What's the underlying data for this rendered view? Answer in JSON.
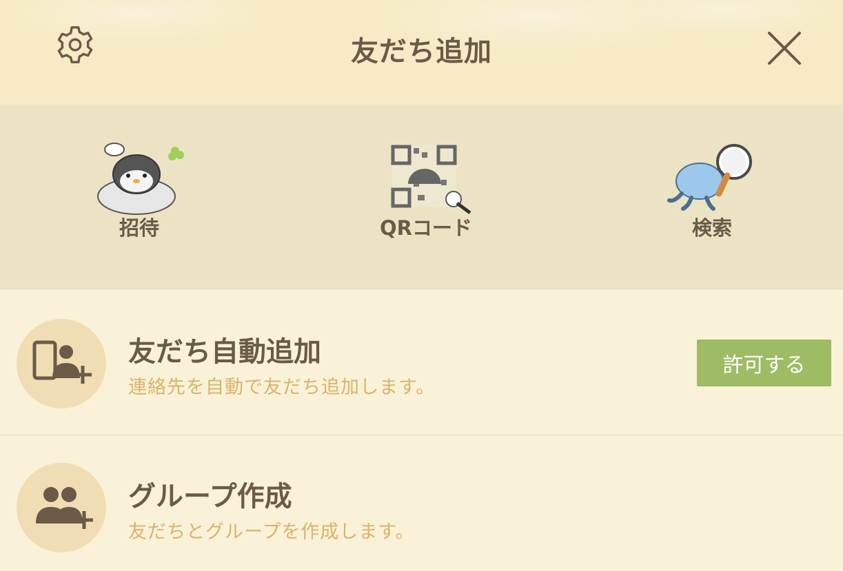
{
  "header": {
    "title": "友だち追加",
    "left_icon": "gear-icon",
    "right_icon": "close-icon"
  },
  "actions": [
    {
      "label": "招待",
      "icon": "penguin-invite-icon"
    },
    {
      "label": "QRコード",
      "icon": "qr-code-icon"
    },
    {
      "label": "検索",
      "icon": "search-magnifier-icon"
    }
  ],
  "rows": [
    {
      "name": "友だち自動追加",
      "desc": "連絡先を自動で友だち追加します。",
      "icon": "phone-contacts-add-icon",
      "button": "許可する"
    },
    {
      "name": "グループ作成",
      "desc": "友だちとグループを作成します。",
      "icon": "group-add-icon"
    }
  ],
  "colors": {
    "header_bg": "#f6ebc6",
    "actions_bg": "#ece3c5",
    "list_bg": "#f9f2d8",
    "accent_green": "#9ebc64",
    "desc_text": "#d9b46c",
    "text": "#6b5a47"
  }
}
